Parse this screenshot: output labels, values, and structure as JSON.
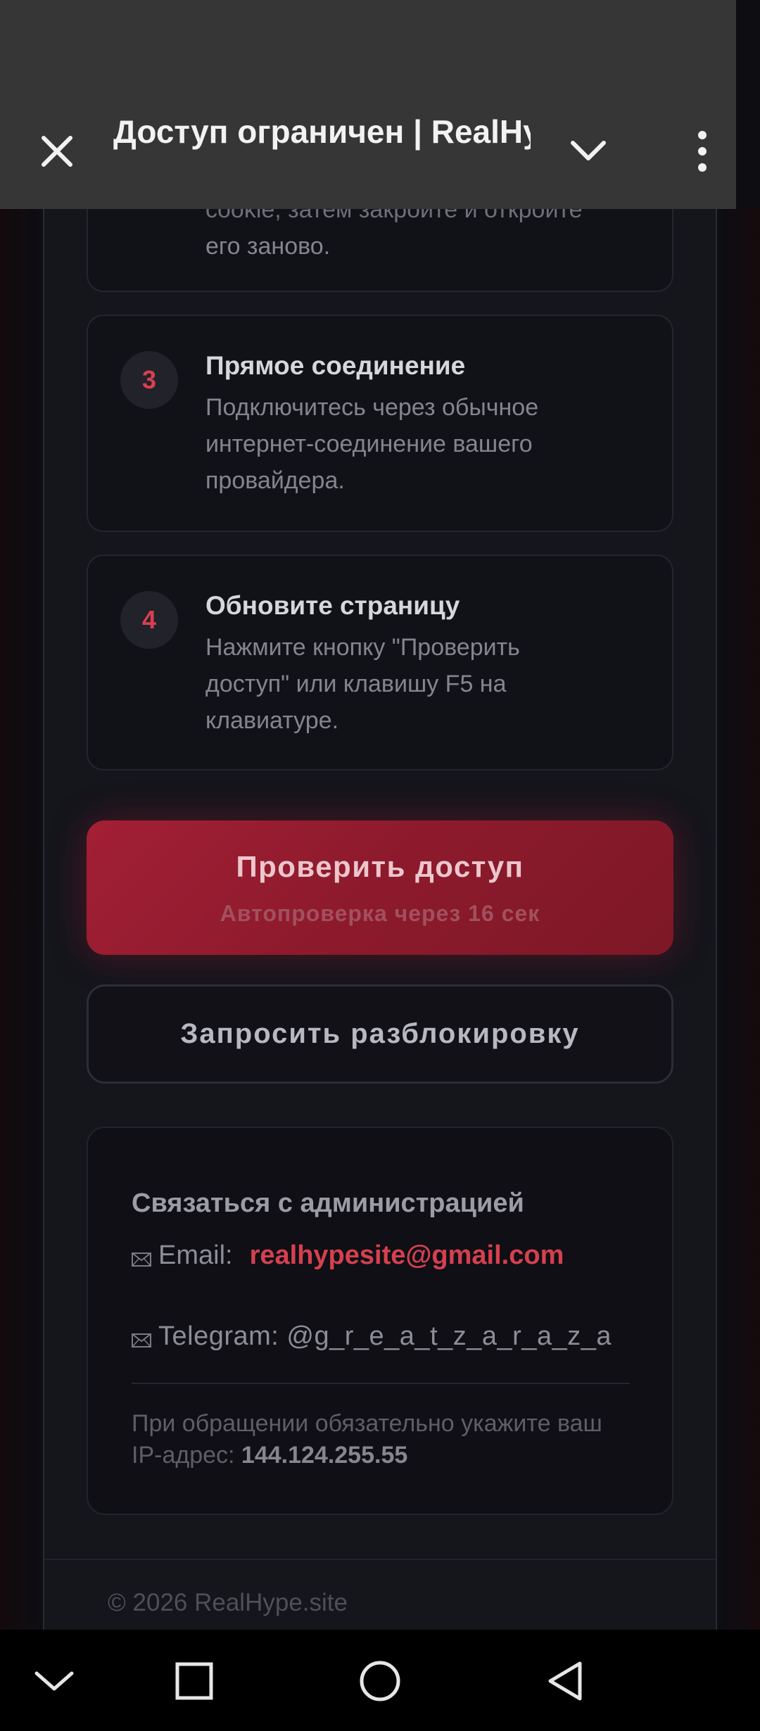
{
  "browser": {
    "title": "Доступ ограничен | RealHype.site",
    "close_icon": "close-icon",
    "collapse_icon": "chevron-down-icon",
    "menu_icon": "more-vertical-icon"
  },
  "steps": [
    {
      "number": "",
      "title": "",
      "description_visible": "cookie, затем закройте и откройте его заново.",
      "partial_line": "cookie, затем закройте и откройте",
      "last_line": "его заново."
    },
    {
      "number": "3",
      "title": "Прямое соединение",
      "lines": [
        "Подключитесь через обычное",
        "интернет-соединение вашего",
        "провайдера."
      ]
    },
    {
      "number": "4",
      "title": "Обновите страницу",
      "lines": [
        "Нажмите кнопку \"Проверить",
        "доступ\" или клавишу F5 на",
        "клавиатуре."
      ]
    }
  ],
  "actions": {
    "check_label": "Проверить доступ",
    "check_sub": "Автопроверка через 16 сек",
    "unblock_label": "Запросить разблокировку"
  },
  "contact": {
    "title": "Связаться с администрацией",
    "email_label": "Email:",
    "email_value": "realhypesite@gmail.com",
    "telegram_text": "Telegram: @g_r_e_a_t_z_a_r_a_z_a",
    "note_text": "При обращении обязательно укажите ваш IP-адрес:",
    "ip": "144.124.255.55",
    "envelope_icon": "envelope-icon"
  },
  "footer": {
    "copyright": "© 2026 RealHype.site"
  },
  "navbar": {
    "items": [
      "chevron-down-icon",
      "square-icon",
      "circle-icon",
      "triangle-back-icon"
    ]
  },
  "colors": {
    "accent": "#d5404f",
    "button_red": "#9a1d31",
    "background": "#0d0d12",
    "header": "#363636"
  }
}
